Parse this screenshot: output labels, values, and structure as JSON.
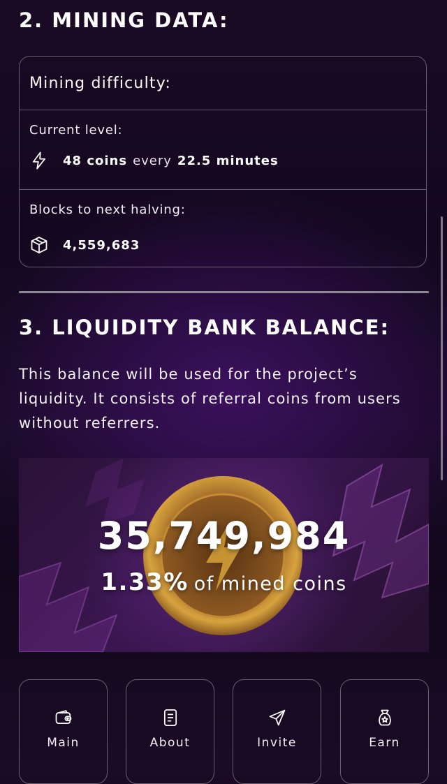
{
  "section2": {
    "title": "2. MINING DATA:"
  },
  "mining_card": {
    "heading": "Mining difficulty:",
    "current_level": {
      "label": "Current level:",
      "coins": "48 coins",
      "every": "every",
      "interval": "22.5 minutes",
      "icon": "lightning-icon"
    },
    "halving": {
      "label": "Blocks to next halving:",
      "value": "4,559,683",
      "icon": "box-icon"
    }
  },
  "section3": {
    "title": "3. LIQUIDITY BANK BALANCE:",
    "description": "This balance will be used for the project’s liquidity. It consists of referral coins from users without referrers."
  },
  "bank": {
    "balance": "35,749,984",
    "percent": "1.33%",
    "percent_text": "of mined coins"
  },
  "nav": [
    {
      "label": "Main",
      "icon": "wallet-icon"
    },
    {
      "label": "About",
      "icon": "document-icon"
    },
    {
      "label": "Invite",
      "icon": "send-icon"
    },
    {
      "label": "Earn",
      "icon": "bag-icon"
    }
  ],
  "colors": {
    "background": "#160a20",
    "accent_purple": "#5a1a8a",
    "coin_gold": "#d9a43a",
    "border": "#5c5663"
  }
}
